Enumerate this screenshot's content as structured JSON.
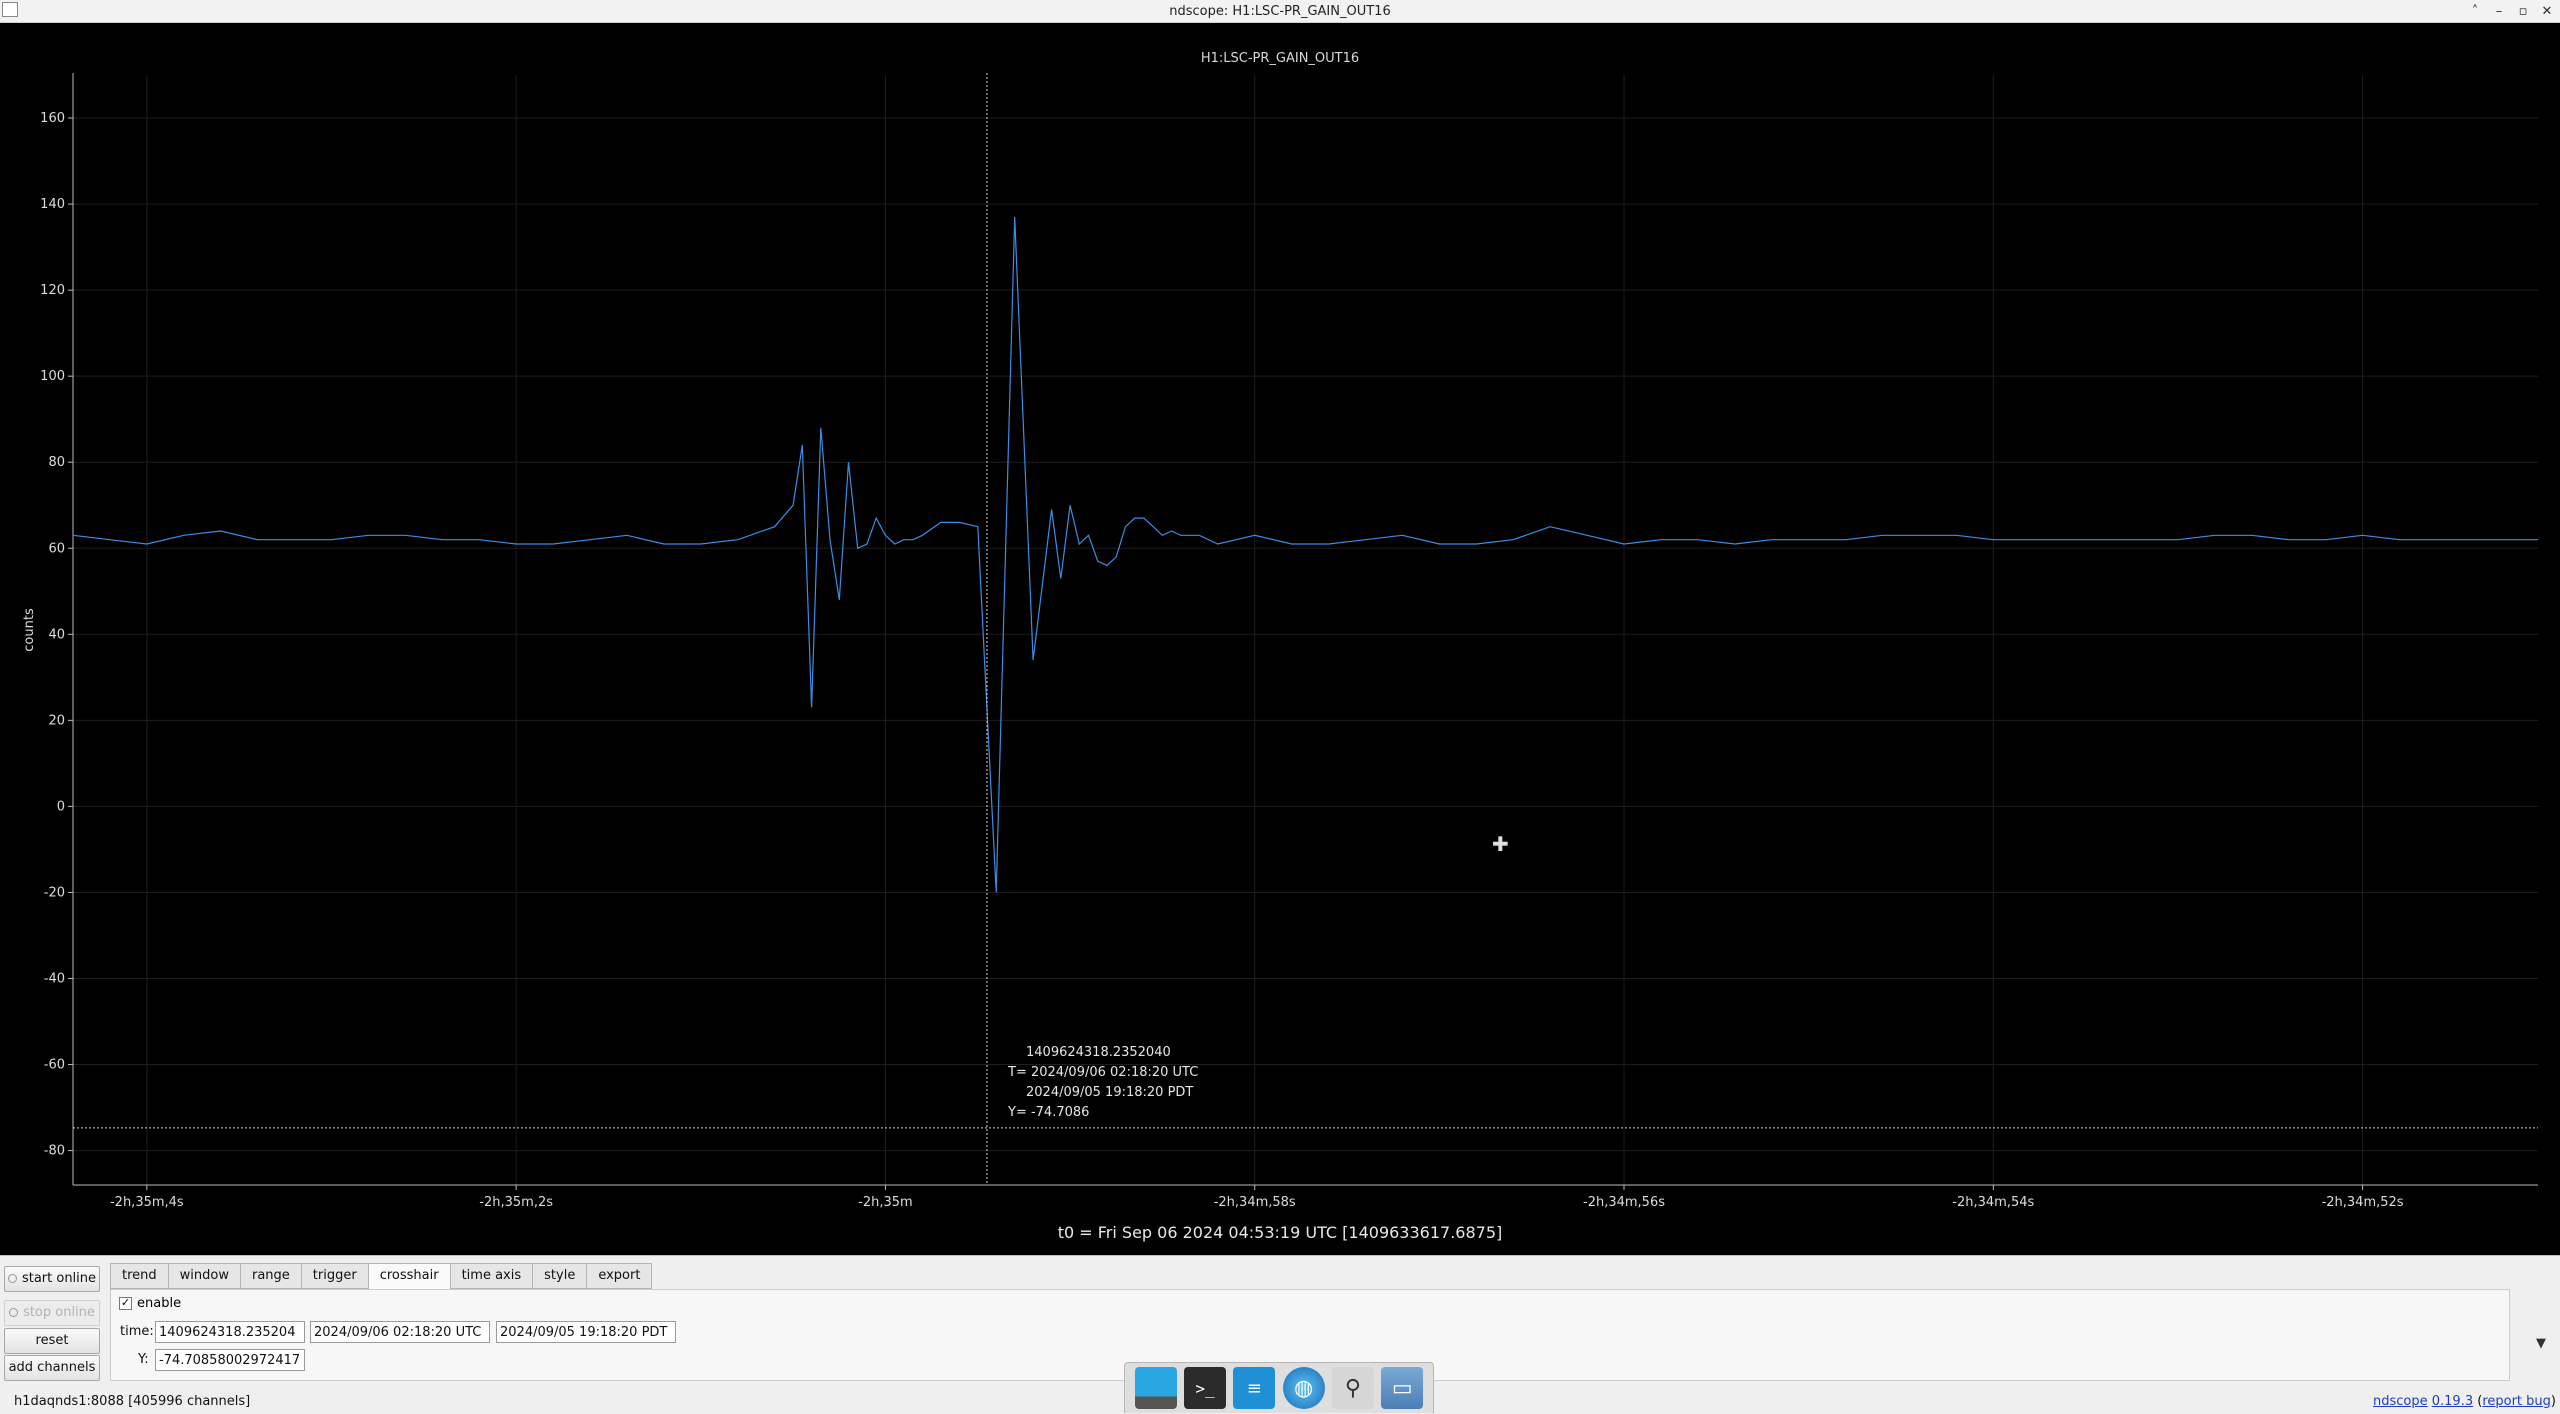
{
  "window": {
    "title": "ndscope: H1:LSC-PR_GAIN_OUT16",
    "buttons": [
      "˄",
      "–",
      "▫",
      "✕"
    ]
  },
  "plot": {
    "title": "H1:LSC-PR_GAIN_OUT16",
    "t0_label": "t0 = Fri Sep 06 2024 04:53:19 UTC [1409633617.6875]",
    "crosshair_readout": {
      "gps": "1409624318.2352040",
      "utc": "T= 2024/09/06 02:18:20 UTC",
      "pdt": "2024/09/05 19:18:20 PDT",
      "y": "Y= -74.7086"
    }
  },
  "chart_data": {
    "type": "line",
    "ylabel": "counts",
    "ylim": [
      -88,
      170
    ],
    "yticks": [
      160,
      140,
      120,
      100,
      80,
      60,
      40,
      20,
      0,
      -20,
      -40,
      -60,
      -80
    ],
    "xlim": [
      -9304.4,
      -9291.05
    ],
    "xticks": [
      {
        "value": -9304,
        "label": "-2h,35m,4s"
      },
      {
        "value": -9302,
        "label": "-2h,35m,2s"
      },
      {
        "value": -9300,
        "label": "-2h,35m"
      },
      {
        "value": -9298,
        "label": "-2h,34m,58s"
      },
      {
        "value": -9296,
        "label": "-2h,34m,56s"
      },
      {
        "value": -9294,
        "label": "-2h,34m,54s"
      },
      {
        "value": -9292,
        "label": "-2h,34m,52s"
      }
    ],
    "grid": true,
    "crosshair": {
      "x": -9299.45,
      "y": -74.7086
    },
    "series": [
      {
        "color": "#3a8ee6",
        "x": [
          -9304.4,
          -9304.2,
          -9304.0,
          -9303.8,
          -9303.6,
          -9303.4,
          -9303.2,
          -9303.0,
          -9302.8,
          -9302.6,
          -9302.4,
          -9302.2,
          -9302.0,
          -9301.8,
          -9301.6,
          -9301.4,
          -9301.2,
          -9301.0,
          -9300.8,
          -9300.6,
          -9300.5,
          -9300.45,
          -9300.4,
          -9300.35,
          -9300.3,
          -9300.25,
          -9300.2,
          -9300.15,
          -9300.1,
          -9300.05,
          -9300.0,
          -9299.95,
          -9299.9,
          -9299.85,
          -9299.8,
          -9299.7,
          -9299.6,
          -9299.5,
          -9299.4,
          -9299.3,
          -9299.2,
          -9299.1,
          -9299.05,
          -9299.0,
          -9298.95,
          -9298.9,
          -9298.85,
          -9298.8,
          -9298.75,
          -9298.7,
          -9298.65,
          -9298.6,
          -9298.55,
          -9298.5,
          -9298.45,
          -9298.4,
          -9298.3,
          -9298.2,
          -9298.1,
          -9298.0,
          -9297.8,
          -9297.6,
          -9297.4,
          -9297.2,
          -9297.0,
          -9296.8,
          -9296.6,
          -9296.4,
          -9296.2,
          -9296.0,
          -9295.8,
          -9295.6,
          -9295.4,
          -9295.2,
          -9295.0,
          -9294.8,
          -9294.6,
          -9294.4,
          -9294.2,
          -9294.0,
          -9293.8,
          -9293.6,
          -9293.4,
          -9293.2,
          -9293.0,
          -9292.8,
          -9292.6,
          -9292.4,
          -9292.2,
          -9292.0,
          -9291.8,
          -9291.6,
          -9291.4,
          -9291.2,
          -9291.05
        ],
        "y": [
          63,
          62,
          61,
          63,
          64,
          62,
          62,
          62,
          63,
          63,
          62,
          62,
          61,
          61,
          62,
          63,
          61,
          61,
          62,
          65,
          70,
          84,
          23,
          88,
          62,
          48,
          80,
          60,
          61,
          67,
          63,
          61,
          62,
          62,
          63,
          66,
          66,
          65,
          -20,
          137,
          34,
          69,
          53,
          70,
          61,
          63,
          57,
          56,
          58,
          65,
          67,
          67,
          65,
          63,
          64,
          63,
          63,
          61,
          62,
          63,
          61,
          61,
          62,
          63,
          61,
          61,
          62,
          65,
          63,
          61,
          62,
          62,
          61,
          62,
          62,
          62,
          63,
          63,
          63,
          62,
          62,
          62,
          62,
          62,
          62,
          63,
          63,
          62,
          62,
          63,
          62,
          62,
          62,
          62,
          62
        ]
      }
    ]
  },
  "controls": {
    "side_buttons": {
      "start_online": "start online",
      "stop_online": "stop online",
      "reset": "reset",
      "add_channels": "add channels"
    },
    "tabs": [
      "trend",
      "window",
      "range",
      "trigger",
      "crosshair",
      "time axis",
      "style",
      "export"
    ],
    "active_tab": "crosshair",
    "crosshair_tab": {
      "enable_label": "enable",
      "enable_checked": "✓",
      "time_label": "time:",
      "time_gps": "1409624318.235204",
      "time_utc": "2024/09/06 02:18:20 UTC",
      "time_pdt": "2024/09/05 19:18:20 PDT",
      "y_label": "Y:",
      "y_value": "-74.70858002972417"
    },
    "collapse_arrow": "▼"
  },
  "status": {
    "server": "h1daqnds1:8088  [405996 channels]",
    "version_prefix": "ndscope",
    "version": "0.19.3",
    "report": "report bug"
  },
  "dock": {
    "items": [
      "desktop",
      "terminal",
      "text-editor",
      "web-browser",
      "search",
      "file-manager"
    ]
  }
}
